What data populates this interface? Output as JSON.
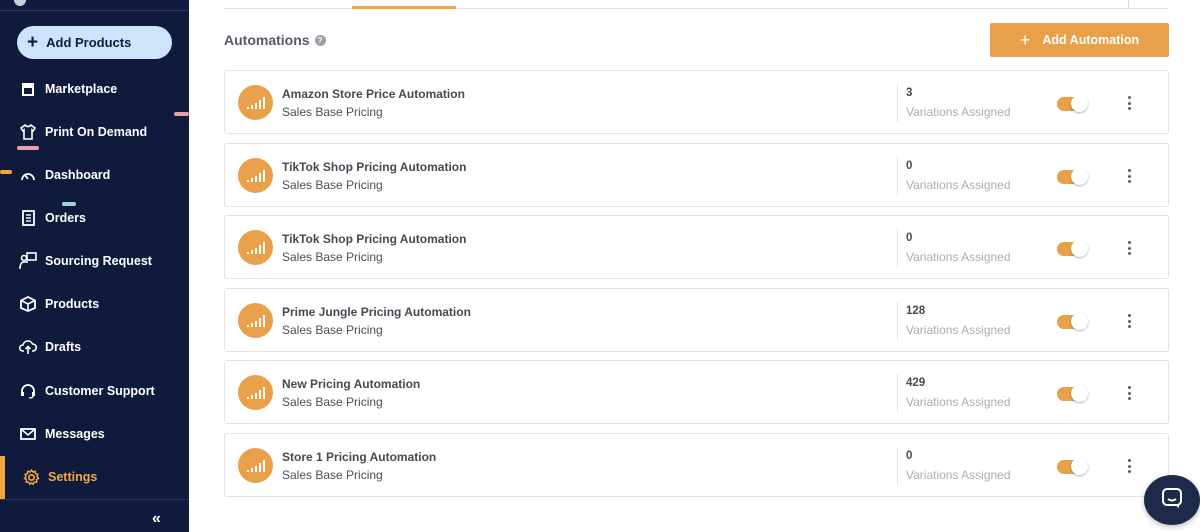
{
  "sidebar": {
    "add_products_label": "Add Products",
    "items": [
      {
        "label": "Marketplace",
        "icon": "store-icon"
      },
      {
        "label": "Print On Demand",
        "icon": "tshirt-icon"
      },
      {
        "label": "Dashboard",
        "icon": "gauge-icon"
      },
      {
        "label": "Orders",
        "icon": "clipboard-icon"
      },
      {
        "label": "Sourcing Request",
        "icon": "presenter-icon"
      },
      {
        "label": "Products",
        "icon": "box-icon"
      },
      {
        "label": "Drafts",
        "icon": "cloud-upload-icon"
      },
      {
        "label": "Customer Support",
        "icon": "headset-icon"
      },
      {
        "label": "Messages",
        "icon": "mail-icon"
      },
      {
        "label": "Settings",
        "icon": "gear-icon"
      }
    ],
    "active_item": "Settings",
    "collapse_label": "«"
  },
  "main": {
    "section_title": "Automations",
    "add_automation_label": "Add Automation",
    "automations": [
      {
        "name": "Amazon Store Price Automation",
        "type": "Sales Base Pricing",
        "count": "3",
        "count_label": "Variations Assigned",
        "enabled": true
      },
      {
        "name": "TikTok Shop Pricing Automation",
        "type": "Sales Base Pricing",
        "count": "0",
        "count_label": "Variations Assigned",
        "enabled": true
      },
      {
        "name": "TikTok Shop Pricing Automation",
        "type": "Sales Base Pricing",
        "count": "0",
        "count_label": "Variations Assigned",
        "enabled": true
      },
      {
        "name": "Prime Jungle Pricing Automation",
        "type": "Sales Base Pricing",
        "count": "128",
        "count_label": "Variations Assigned",
        "enabled": true
      },
      {
        "name": "New Pricing Automation",
        "type": "Sales Base Pricing",
        "count": "429",
        "count_label": "Variations Assigned",
        "enabled": true
      },
      {
        "name": "Store 1 Pricing Automation",
        "type": "Sales Base Pricing",
        "count": "0",
        "count_label": "Variations Assigned",
        "enabled": true
      }
    ]
  },
  "colors": {
    "sidebar_bg": "#0f1a3c",
    "accent": "#e8a04a",
    "add_products_bg": "#cfe3fb"
  }
}
